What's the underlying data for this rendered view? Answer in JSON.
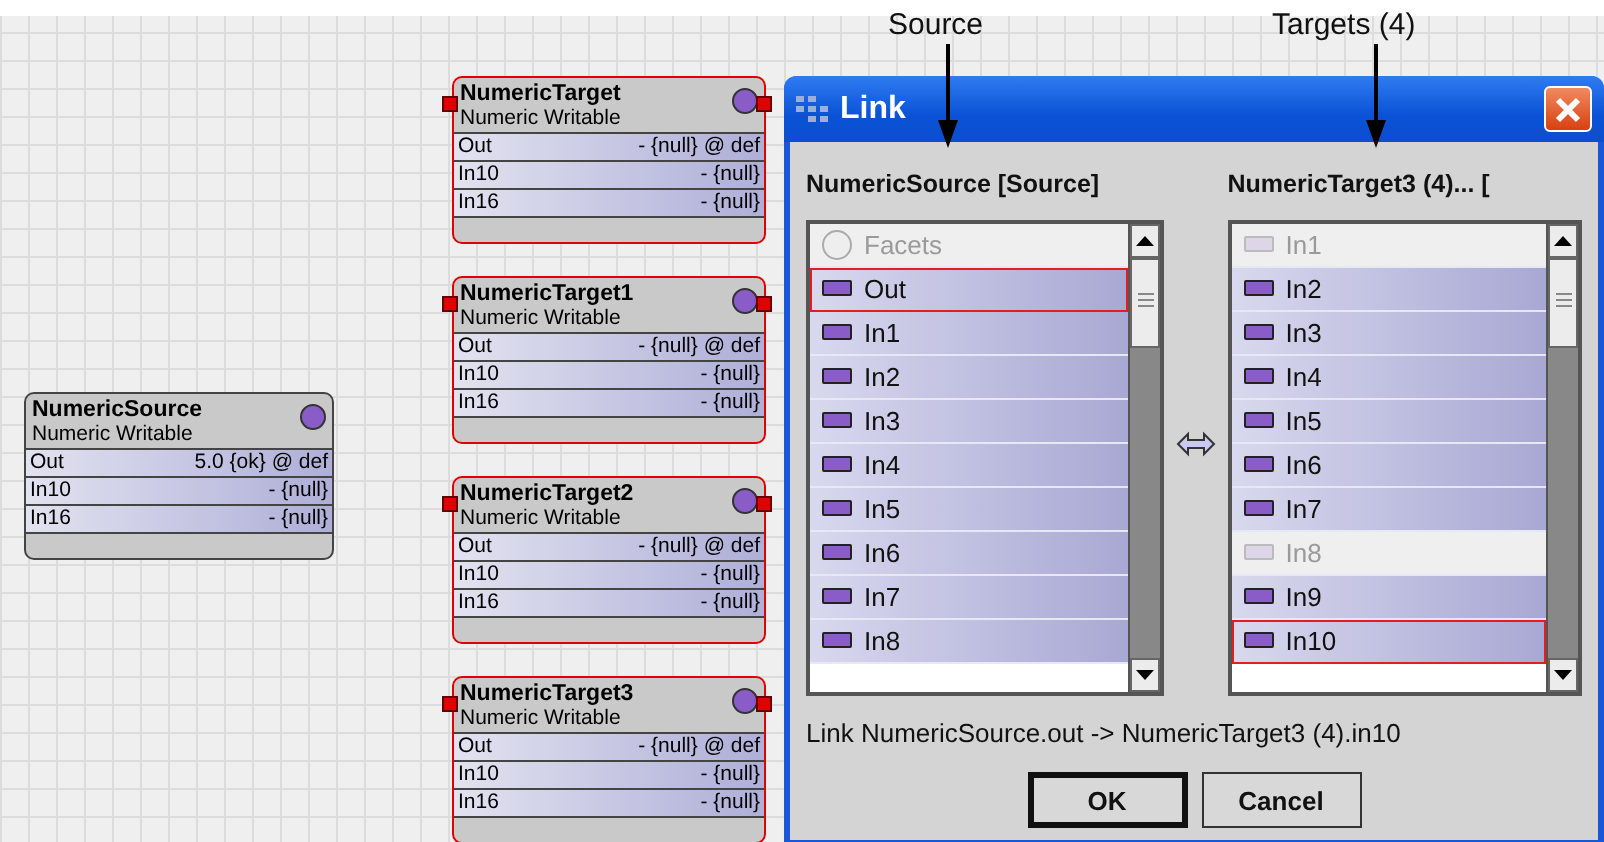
{
  "annotations": [
    {
      "text": "Source"
    },
    {
      "text": "Targets (4)"
    }
  ],
  "nodes": [
    {
      "name": "NumericSource",
      "type": "Numeric Writable",
      "highlighted": false,
      "slots": [
        {
          "label": "Out",
          "value": "5.0 {ok} @ def"
        },
        {
          "label": "In10",
          "value": "- {null}"
        },
        {
          "label": "In16",
          "value": "- {null}"
        }
      ]
    },
    {
      "name": "NumericTarget",
      "type": "Numeric Writable",
      "highlighted": true,
      "slots": [
        {
          "label": "Out",
          "value": "- {null} @ def"
        },
        {
          "label": "In10",
          "value": "- {null}"
        },
        {
          "label": "In16",
          "value": "- {null}"
        }
      ]
    },
    {
      "name": "NumericTarget1",
      "type": "Numeric Writable",
      "highlighted": true,
      "slots": [
        {
          "label": "Out",
          "value": "- {null} @ def"
        },
        {
          "label": "In10",
          "value": "- {null}"
        },
        {
          "label": "In16",
          "value": "- {null}"
        }
      ]
    },
    {
      "name": "NumericTarget2",
      "type": "Numeric Writable",
      "highlighted": true,
      "slots": [
        {
          "label": "Out",
          "value": "- {null} @ def"
        },
        {
          "label": "In10",
          "value": "- {null}"
        },
        {
          "label": "In16",
          "value": "- {null}"
        }
      ]
    },
    {
      "name": "NumericTarget3",
      "type": "Numeric Writable",
      "highlighted": true,
      "slots": [
        {
          "label": "Out",
          "value": "- {null} @ def"
        },
        {
          "label": "In10",
          "value": "- {null}"
        },
        {
          "label": "In16",
          "value": "- {null}"
        }
      ]
    }
  ],
  "dialog": {
    "title": "Link",
    "source": {
      "header": "NumericSource [Source]",
      "items": [
        {
          "label": "Facets",
          "kind": "property",
          "disabled": true,
          "selected": false
        },
        {
          "label": "Out",
          "kind": "slot",
          "disabled": false,
          "selected": true
        },
        {
          "label": "In1",
          "kind": "slot",
          "disabled": false,
          "selected": false
        },
        {
          "label": "In2",
          "kind": "slot",
          "disabled": false,
          "selected": false
        },
        {
          "label": "In3",
          "kind": "slot",
          "disabled": false,
          "selected": false
        },
        {
          "label": "In4",
          "kind": "slot",
          "disabled": false,
          "selected": false
        },
        {
          "label": "In5",
          "kind": "slot",
          "disabled": false,
          "selected": false
        },
        {
          "label": "In6",
          "kind": "slot",
          "disabled": false,
          "selected": false
        },
        {
          "label": "In7",
          "kind": "slot",
          "disabled": false,
          "selected": false
        },
        {
          "label": "In8",
          "kind": "slot",
          "disabled": false,
          "selected": false
        }
      ]
    },
    "target": {
      "header": "NumericTarget3 (4)... [",
      "items": [
        {
          "label": "In1",
          "kind": "slot",
          "disabled": true,
          "selected": false
        },
        {
          "label": "In2",
          "kind": "slot",
          "disabled": false,
          "selected": false
        },
        {
          "label": "In3",
          "kind": "slot",
          "disabled": false,
          "selected": false
        },
        {
          "label": "In4",
          "kind": "slot",
          "disabled": false,
          "selected": false
        },
        {
          "label": "In5",
          "kind": "slot",
          "disabled": false,
          "selected": false
        },
        {
          "label": "In6",
          "kind": "slot",
          "disabled": false,
          "selected": false
        },
        {
          "label": "In7",
          "kind": "slot",
          "disabled": false,
          "selected": false
        },
        {
          "label": "In8",
          "kind": "slot",
          "disabled": true,
          "selected": false
        },
        {
          "label": "In9",
          "kind": "slot",
          "disabled": false,
          "selected": false
        },
        {
          "label": "In10",
          "kind": "slot",
          "disabled": false,
          "selected": true
        }
      ]
    },
    "link_text": "Link NumericSource.out -> NumericTarget3 (4).in10",
    "buttons": [
      {
        "label": "OK",
        "default": true
      },
      {
        "label": "Cancel",
        "default": false
      }
    ]
  }
}
